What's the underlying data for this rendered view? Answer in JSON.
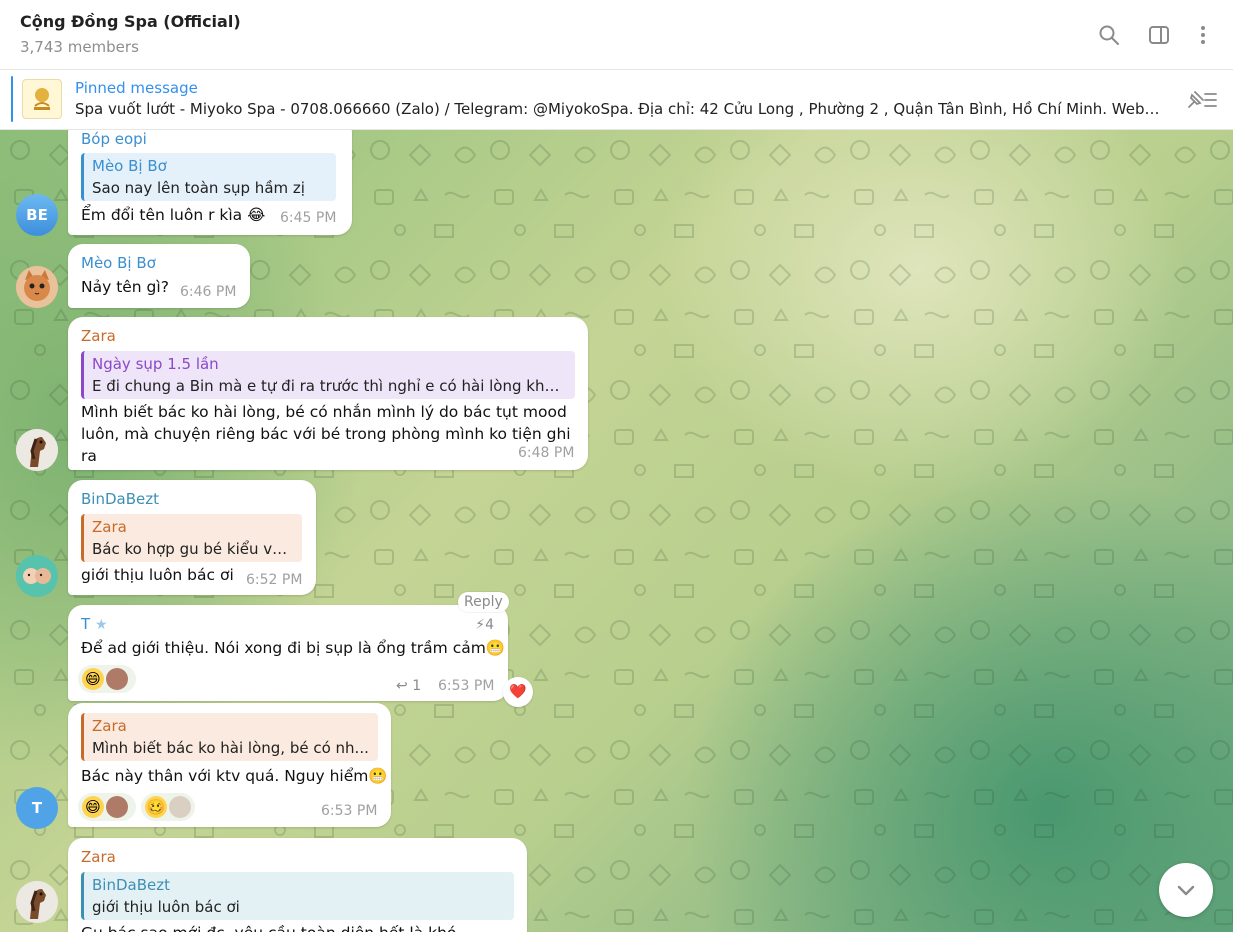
{
  "header": {
    "title": "Cộng Đồng Spa (Official)",
    "subtitle": "3,743 members",
    "icons": [
      "search-icon",
      "sidebar-toggle-icon",
      "more-vertical-icon"
    ]
  },
  "pinned": {
    "title": "Pinned message",
    "text": "Spa vuốt lướt  - Miyoko Spa - 0708.066660 (Zalo) / Telegram: @MiyokoSpa.  Địa chỉ: 42 Cửu Long , Phường 2 , Quận Tân Bình, Hồ Chí Minh. Websi..."
  },
  "messages": [
    {
      "sender": "Bóp eopi",
      "reply_to": {
        "name": "Mèo Bị Bơ",
        "text": "Sao nay lên toàn sụp hầm zị"
      },
      "text": "Ểm đổi tên luôn r kìa 😂",
      "time": "6:45 PM",
      "avatar_text": "BE"
    },
    {
      "sender": "Mèo Bị Bơ",
      "text": "Nảy tên gì?",
      "time": "6:46 PM"
    },
    {
      "sender": "Zara",
      "reply_to": {
        "name": "Ngày sụp 1.5 lần",
        "text": "E đi chung a Bin mà e tự đi ra trước thì nghỉ e có hài lòng khô..."
      },
      "text_lines": [
        "Mình biết bác ko hài lòng, bé có nhắn mình lý do bác tụt mood",
        "luôn, mà chuyện riêng bác với bé trong phòng mình ko tiện ghi ra"
      ],
      "time": "6:48 PM"
    },
    {
      "sender": "BinDaBezt",
      "reply_to": {
        "name": "Zara",
        "text": "Bác ko hợp gu bé kiểu vậ..."
      },
      "text": "giới thịu luôn bác ơi",
      "time": "6:52 PM"
    },
    {
      "sender": "T",
      "text": "Để ad giới thiệu. Nói xong đi bị sụp là ổng trầm cảm😬",
      "time": "6:53 PM",
      "reply_pill": "Reply",
      "boost_count": "4",
      "replies_count": "1",
      "heart": "❤️"
    },
    {
      "reply_to": {
        "name": "Zara",
        "text": "Mình biết bác ko hài lòng, bé có nh..."
      },
      "text": "Bác này thân với ktv quá. Nguy hiểm😬",
      "time": "6:53 PM",
      "avatar_text": "T"
    },
    {
      "sender": "Zara",
      "reply_to": {
        "name": "BinDaBezt",
        "text": "giới thịu luôn bác ơi"
      },
      "text": "Gu bác sao mới đc, yêu cầu toàn diện hết là khó"
    }
  ],
  "colors": {
    "accent": "#3390ec",
    "zara": "#c86b2a",
    "ngay_sup": "#8b48c9",
    "meo_bi_bo": "#3a8fcf",
    "bindabezt": "#3d8fb5",
    "t_avatar": "#4fa3e6"
  }
}
